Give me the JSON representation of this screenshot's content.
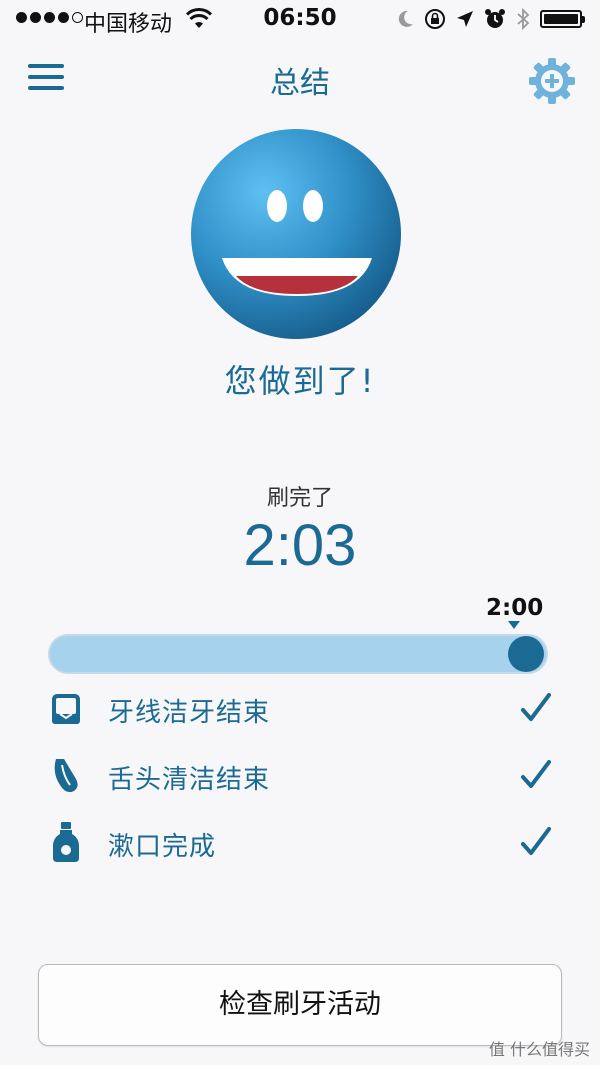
{
  "status_bar": {
    "carrier": "中国移动",
    "time": "06:50"
  },
  "header": {
    "title": "总结",
    "menu_icon": "menu-icon",
    "settings_icon": "gear-plus-icon"
  },
  "summary": {
    "message": "您做到了!"
  },
  "brushing": {
    "label": "刷完了",
    "time": "2:03",
    "target_label": "2:00",
    "progress": 1.0
  },
  "tasks": [
    {
      "label": "牙线洁牙结束",
      "icon": "floss-icon",
      "done": true
    },
    {
      "label": "舌头清洁结束",
      "icon": "tongue-icon",
      "done": true
    },
    {
      "label": "漱口完成",
      "icon": "mouthwash-icon",
      "done": true
    }
  ],
  "actions": {
    "check_activity_label": "检查刷牙活动"
  },
  "watermark": "值 什么值得买",
  "colors": {
    "accent": "#1b6a93",
    "progress_track": "#a7d2ee",
    "background": "#f7f7f9"
  }
}
